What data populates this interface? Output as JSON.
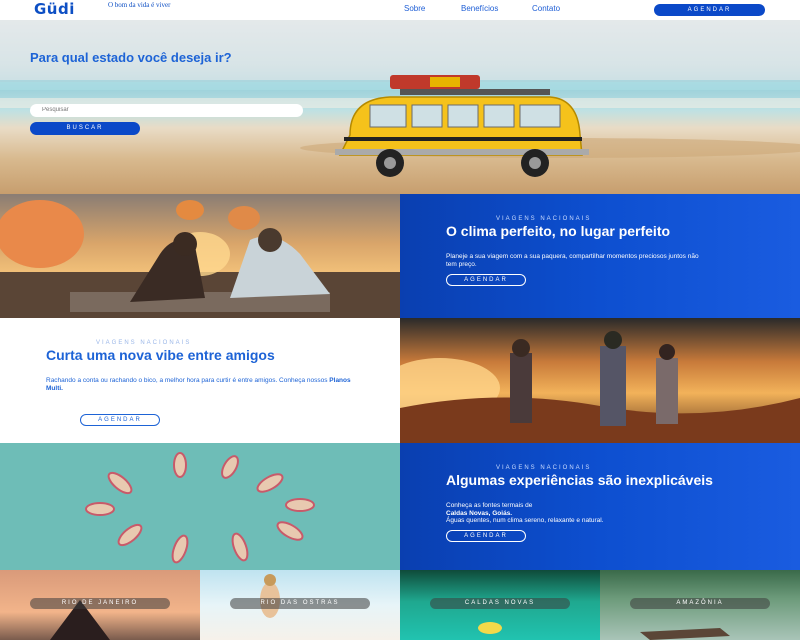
{
  "nav": {
    "logo": "Güdi",
    "tagline": "O bom da vida é viver",
    "links": [
      "Sobre",
      "Benefícios",
      "Contato"
    ],
    "cta": "AGENDAR"
  },
  "hero": {
    "title": "Para qual estado você deseja ir?",
    "search_placeholder": "Pesquisar",
    "button": "BUSCAR"
  },
  "sections": [
    {
      "eyebrow": "VIAGENS NACIONAIS",
      "title": "O clima perfeito, no lugar perfeito",
      "body": "Planeje a sua viagem com a sua paquera, compartilhar momentos preciosos juntos não tem preço.",
      "button": "AGENDAR"
    },
    {
      "eyebrow": "VIAGENS NACIONAIS",
      "title": "Curta uma nova vibe entre amigos",
      "body": "Rachando a conta ou rachando o bico, a melhor hora para curtir é entre amigos. Conheça nossos",
      "body_bold": "Planos Multi.",
      "button": "AGENDAR"
    },
    {
      "eyebrow": "VIAGENS NACIONAIS",
      "title": "Algumas experiências são inexplicáveis",
      "body_intro": "Conheça as fontes termais de",
      "body_bold": "Caldas Novas, Goiás.",
      "body_rest": "Águas quentes, num clima sereno, relaxante e natural.",
      "button": "AGENDAR"
    }
  ],
  "destinations": [
    "RIO DE JANEIRO",
    "RIO DAS OSTRAS",
    "CALDAS NOVAS",
    "AMAZÔNIA"
  ],
  "colors": {
    "brand": "#0b49c8",
    "brand_light": "#1d63d6"
  }
}
